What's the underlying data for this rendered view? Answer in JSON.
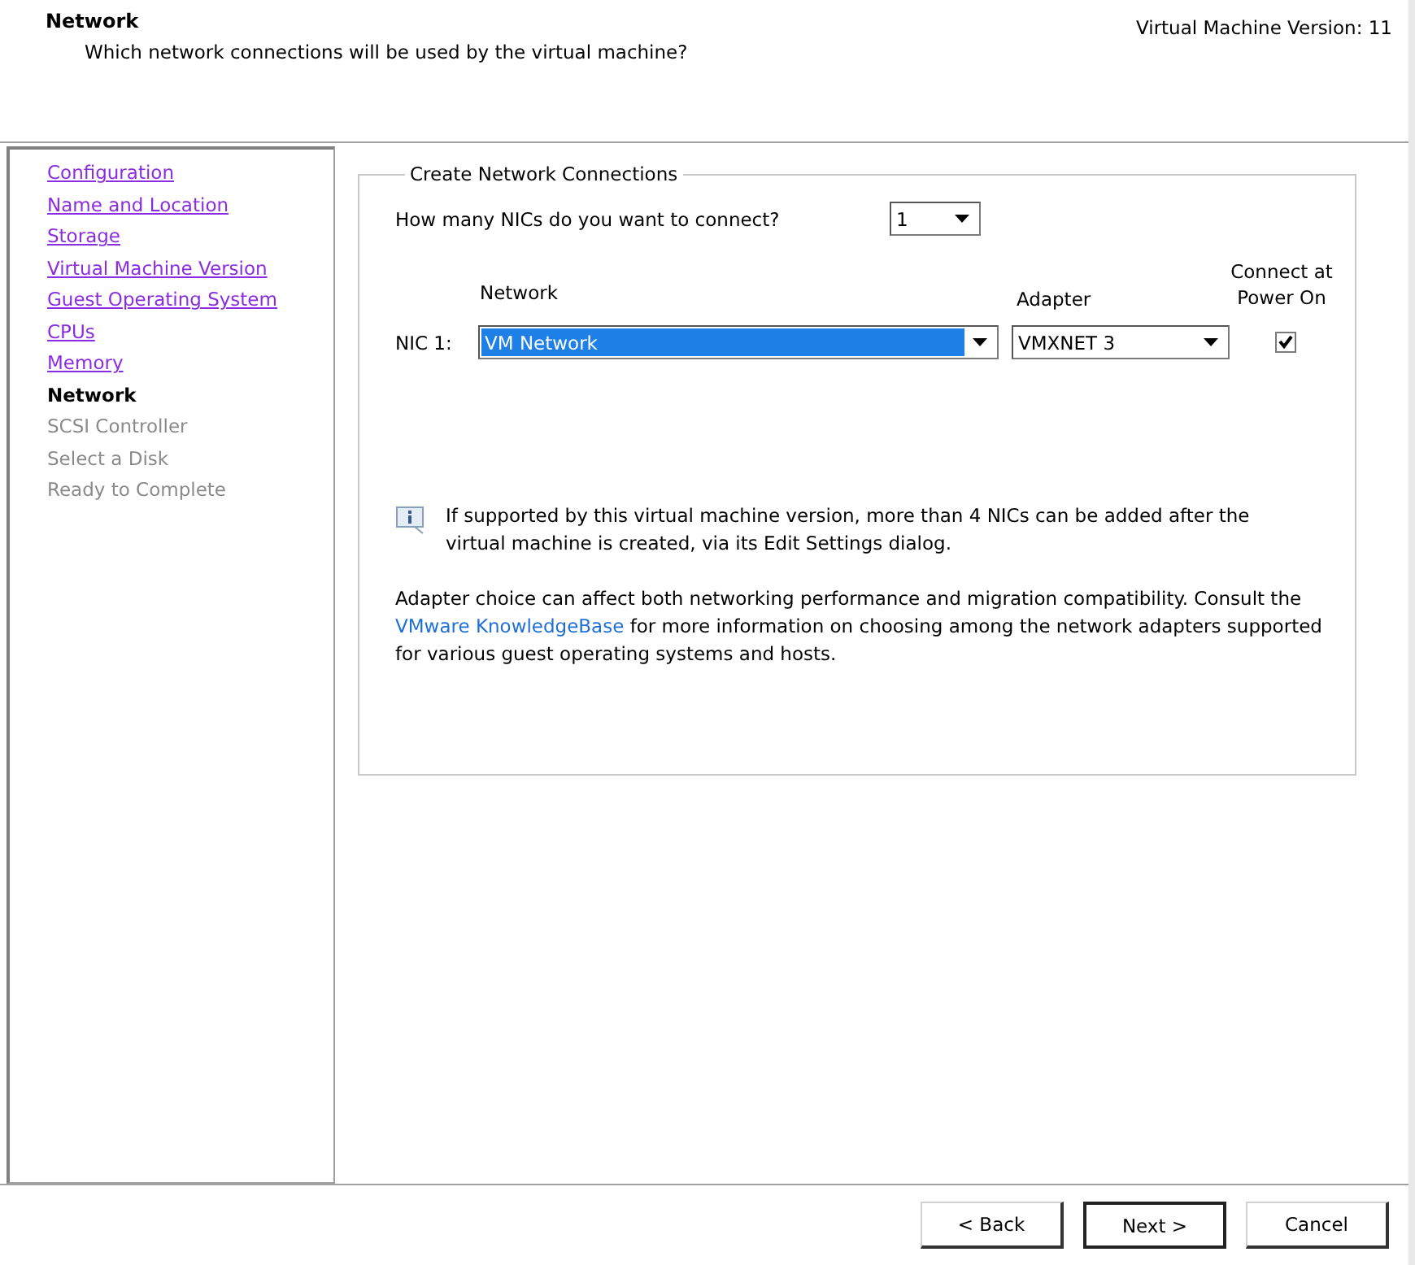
{
  "header": {
    "title": "Network",
    "subtitle": "Which network connections will be used by the virtual machine?",
    "version": "Virtual Machine Version: 11"
  },
  "steps": [
    {
      "label": "Configuration",
      "kind": "done"
    },
    {
      "label": "Name and Location",
      "kind": "done"
    },
    {
      "label": "Storage",
      "kind": "done"
    },
    {
      "label": "Virtual Machine Version",
      "kind": "done"
    },
    {
      "label": "Guest Operating System",
      "kind": "done"
    },
    {
      "label": "CPUs",
      "kind": "done"
    },
    {
      "label": "Memory",
      "kind": "done"
    },
    {
      "label": "Network",
      "kind": "current"
    },
    {
      "label": "SCSI Controller",
      "kind": "pending"
    },
    {
      "label": "Select a Disk",
      "kind": "pending"
    },
    {
      "label": "Ready to Complete",
      "kind": "pending"
    }
  ],
  "group": {
    "title": "Create Network Connections",
    "nic_count_label": "How many NICs do you want to connect?",
    "nic_count": "1",
    "columns": {
      "network": "Network",
      "adapter": "Adapter",
      "connect": "Connect at Power On"
    },
    "nics": [
      {
        "label": "NIC 1:",
        "network": "VM Network",
        "adapter": "VMXNET 3",
        "checked": true
      }
    ],
    "info": "If supported by this virtual machine version, more than 4 NICs can be added after the virtual machine is created, via its Edit Settings dialog.",
    "note_before": "Adapter choice can affect both networking performance and migration compatibility. Consult the",
    "note_link": "VMware KnowledgeBase",
    "note_after": "for more information on choosing among the network adapters supported for various guest operating systems and hosts."
  },
  "buttons": [
    "< Back",
    "Next >",
    "Cancel"
  ]
}
